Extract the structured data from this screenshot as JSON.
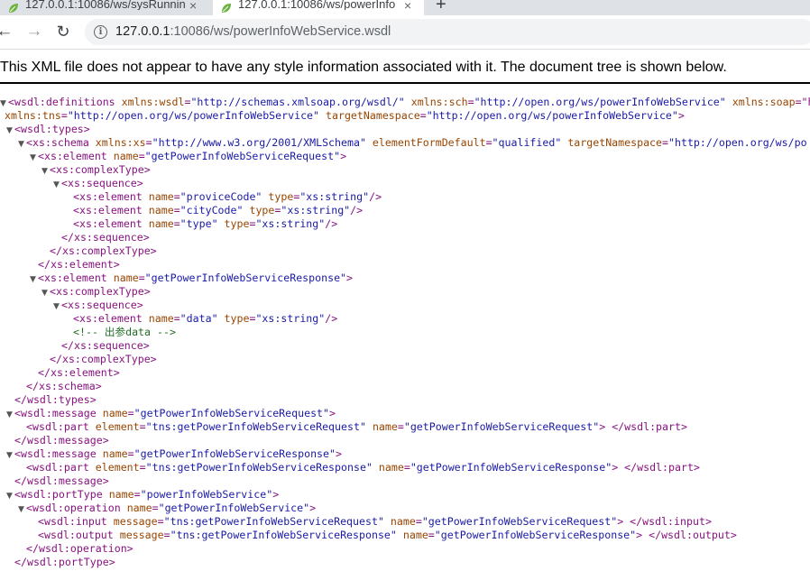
{
  "tabs": [
    {
      "title": "127.0.0.1:10086/ws/sysRunnin",
      "active": false
    },
    {
      "title": "127.0.0.1:10086/ws/powerInfo",
      "active": true
    }
  ],
  "toolbar": {
    "url_host": "127.0.0.1",
    "url_rest": ":10086/ws/powerInfoWebService.wsdl"
  },
  "viewer": {
    "notice": "This XML file does not appear to have any style information associated with it. The document tree is shown below."
  },
  "colors": {
    "tag": "#881280",
    "attr_name": "#994500",
    "attr_value": "#1a1aa6",
    "comment": "#236e25"
  },
  "xml_lines": [
    {
      "indent": 0,
      "toggle": true,
      "parts": [
        [
          "tag",
          "<wsdl:definitions "
        ],
        [
          "an",
          "xmlns:wsdl"
        ],
        [
          "tag",
          "="
        ],
        [
          "av",
          "\"http://schemas.xmlsoap.org/wsdl/\""
        ],
        [
          "tag",
          " "
        ],
        [
          "an",
          "xmlns:sch"
        ],
        [
          "tag",
          "="
        ],
        [
          "av",
          "\"http://open.org/ws/powerInfoWebService\""
        ],
        [
          "tag",
          " "
        ],
        [
          "an",
          "xmlns:soap"
        ],
        [
          "tag",
          "=\"h"
        ]
      ]
    },
    {
      "indent": 0,
      "toggle": false,
      "parts": [
        [
          "an",
          "xmlns:tns"
        ],
        [
          "tag",
          "="
        ],
        [
          "av",
          "\"http://open.org/ws/powerInfoWebService\""
        ],
        [
          "tag",
          " "
        ],
        [
          "an",
          "targetNamespace"
        ],
        [
          "tag",
          "="
        ],
        [
          "av",
          "\"http://open.org/ws/powerInfoWebService\""
        ],
        [
          "tag",
          ">"
        ]
      ]
    },
    {
      "indent": 1,
      "toggle": true,
      "parts": [
        [
          "tag",
          "<wsdl:types>"
        ]
      ]
    },
    {
      "indent": 2,
      "toggle": true,
      "parts": [
        [
          "tag",
          "<xs:schema "
        ],
        [
          "an",
          "xmlns:xs"
        ],
        [
          "tag",
          "="
        ],
        [
          "av",
          "\"http://www.w3.org/2001/XMLSchema\""
        ],
        [
          "tag",
          " "
        ],
        [
          "an",
          "elementFormDefault"
        ],
        [
          "tag",
          "="
        ],
        [
          "av",
          "\"qualified\""
        ],
        [
          "tag",
          " "
        ],
        [
          "an",
          "targetNamespace"
        ],
        [
          "tag",
          "="
        ],
        [
          "av",
          "\"http://open.org/ws/po"
        ]
      ]
    },
    {
      "indent": 3,
      "toggle": true,
      "parts": [
        [
          "tag",
          "<xs:element "
        ],
        [
          "an",
          "name"
        ],
        [
          "tag",
          "="
        ],
        [
          "av",
          "\"getPowerInfoWebServiceRequest\""
        ],
        [
          "tag",
          ">"
        ]
      ]
    },
    {
      "indent": 4,
      "toggle": true,
      "parts": [
        [
          "tag",
          "<xs:complexType>"
        ]
      ]
    },
    {
      "indent": 5,
      "toggle": true,
      "parts": [
        [
          "tag",
          "<xs:sequence>"
        ]
      ]
    },
    {
      "indent": 6,
      "toggle": false,
      "parts": [
        [
          "tag",
          "<xs:element "
        ],
        [
          "an",
          "name"
        ],
        [
          "tag",
          "="
        ],
        [
          "av",
          "\"proviceCode\""
        ],
        [
          "tag",
          " "
        ],
        [
          "an",
          "type"
        ],
        [
          "tag",
          "="
        ],
        [
          "av",
          "\"xs:string\""
        ],
        [
          "tag",
          "/>"
        ]
      ]
    },
    {
      "indent": 6,
      "toggle": false,
      "parts": [
        [
          "tag",
          "<xs:element "
        ],
        [
          "an",
          "name"
        ],
        [
          "tag",
          "="
        ],
        [
          "av",
          "\"cityCode\""
        ],
        [
          "tag",
          " "
        ],
        [
          "an",
          "type"
        ],
        [
          "tag",
          "="
        ],
        [
          "av",
          "\"xs:string\""
        ],
        [
          "tag",
          "/>"
        ]
      ]
    },
    {
      "indent": 6,
      "toggle": false,
      "parts": [
        [
          "tag",
          "<xs:element "
        ],
        [
          "an",
          "name"
        ],
        [
          "tag",
          "="
        ],
        [
          "av",
          "\"type\""
        ],
        [
          "tag",
          " "
        ],
        [
          "an",
          "type"
        ],
        [
          "tag",
          "="
        ],
        [
          "av",
          "\"xs:string\""
        ],
        [
          "tag",
          "/>"
        ]
      ]
    },
    {
      "indent": 5,
      "toggle": false,
      "parts": [
        [
          "tag",
          "</xs:sequence>"
        ]
      ]
    },
    {
      "indent": 4,
      "toggle": false,
      "parts": [
        [
          "tag",
          "</xs:complexType>"
        ]
      ]
    },
    {
      "indent": 3,
      "toggle": false,
      "parts": [
        [
          "tag",
          "</xs:element>"
        ]
      ]
    },
    {
      "indent": 3,
      "toggle": true,
      "parts": [
        [
          "tag",
          "<xs:element "
        ],
        [
          "an",
          "name"
        ],
        [
          "tag",
          "="
        ],
        [
          "av",
          "\"getPowerInfoWebServiceResponse\""
        ],
        [
          "tag",
          ">"
        ]
      ]
    },
    {
      "indent": 4,
      "toggle": true,
      "parts": [
        [
          "tag",
          "<xs:complexType>"
        ]
      ]
    },
    {
      "indent": 5,
      "toggle": true,
      "parts": [
        [
          "tag",
          "<xs:sequence>"
        ]
      ]
    },
    {
      "indent": 6,
      "toggle": false,
      "parts": [
        [
          "tag",
          "<xs:element "
        ],
        [
          "an",
          "name"
        ],
        [
          "tag",
          "="
        ],
        [
          "av",
          "\"data\""
        ],
        [
          "tag",
          " "
        ],
        [
          "an",
          "type"
        ],
        [
          "tag",
          "="
        ],
        [
          "av",
          "\"xs:string\""
        ],
        [
          "tag",
          "/>"
        ]
      ]
    },
    {
      "indent": 6,
      "toggle": false,
      "parts": [
        [
          "cm",
          "<!-- 出参data -->"
        ]
      ]
    },
    {
      "indent": 5,
      "toggle": false,
      "parts": [
        [
          "tag",
          "</xs:sequence>"
        ]
      ]
    },
    {
      "indent": 4,
      "toggle": false,
      "parts": [
        [
          "tag",
          "</xs:complexType>"
        ]
      ]
    },
    {
      "indent": 3,
      "toggle": false,
      "parts": [
        [
          "tag",
          "</xs:element>"
        ]
      ]
    },
    {
      "indent": 2,
      "toggle": false,
      "parts": [
        [
          "tag",
          "</xs:schema>"
        ]
      ]
    },
    {
      "indent": 1,
      "toggle": false,
      "parts": [
        [
          "tag",
          "</wsdl:types>"
        ]
      ]
    },
    {
      "indent": 1,
      "toggle": true,
      "parts": [
        [
          "tag",
          "<wsdl:message "
        ],
        [
          "an",
          "name"
        ],
        [
          "tag",
          "="
        ],
        [
          "av",
          "\"getPowerInfoWebServiceRequest\""
        ],
        [
          "tag",
          ">"
        ]
      ]
    },
    {
      "indent": 2,
      "toggle": false,
      "parts": [
        [
          "tag",
          "<wsdl:part "
        ],
        [
          "an",
          "element"
        ],
        [
          "tag",
          "="
        ],
        [
          "av",
          "\"tns:getPowerInfoWebServiceRequest\""
        ],
        [
          "tag",
          " "
        ],
        [
          "an",
          "name"
        ],
        [
          "tag",
          "="
        ],
        [
          "av",
          "\"getPowerInfoWebServiceRequest\""
        ],
        [
          "tag",
          "> </wsdl:part>"
        ]
      ]
    },
    {
      "indent": 1,
      "toggle": false,
      "parts": [
        [
          "tag",
          "</wsdl:message>"
        ]
      ]
    },
    {
      "indent": 1,
      "toggle": true,
      "parts": [
        [
          "tag",
          "<wsdl:message "
        ],
        [
          "an",
          "name"
        ],
        [
          "tag",
          "="
        ],
        [
          "av",
          "\"getPowerInfoWebServiceResponse\""
        ],
        [
          "tag",
          ">"
        ]
      ]
    },
    {
      "indent": 2,
      "toggle": false,
      "parts": [
        [
          "tag",
          "<wsdl:part "
        ],
        [
          "an",
          "element"
        ],
        [
          "tag",
          "="
        ],
        [
          "av",
          "\"tns:getPowerInfoWebServiceResponse\""
        ],
        [
          "tag",
          " "
        ],
        [
          "an",
          "name"
        ],
        [
          "tag",
          "="
        ],
        [
          "av",
          "\"getPowerInfoWebServiceResponse\""
        ],
        [
          "tag",
          "> </wsdl:part>"
        ]
      ]
    },
    {
      "indent": 1,
      "toggle": false,
      "parts": [
        [
          "tag",
          "</wsdl:message>"
        ]
      ]
    },
    {
      "indent": 1,
      "toggle": true,
      "parts": [
        [
          "tag",
          "<wsdl:portType "
        ],
        [
          "an",
          "name"
        ],
        [
          "tag",
          "="
        ],
        [
          "av",
          "\"powerInfoWebService\""
        ],
        [
          "tag",
          ">"
        ]
      ]
    },
    {
      "indent": 2,
      "toggle": true,
      "parts": [
        [
          "tag",
          "<wsdl:operation "
        ],
        [
          "an",
          "name"
        ],
        [
          "tag",
          "="
        ],
        [
          "av",
          "\"getPowerInfoWebService\""
        ],
        [
          "tag",
          ">"
        ]
      ]
    },
    {
      "indent": 3,
      "toggle": false,
      "parts": [
        [
          "tag",
          "<wsdl:input "
        ],
        [
          "an",
          "message"
        ],
        [
          "tag",
          "="
        ],
        [
          "av",
          "\"tns:getPowerInfoWebServiceRequest\""
        ],
        [
          "tag",
          " "
        ],
        [
          "an",
          "name"
        ],
        [
          "tag",
          "="
        ],
        [
          "av",
          "\"getPowerInfoWebServiceRequest\""
        ],
        [
          "tag",
          "> </wsdl:input>"
        ]
      ]
    },
    {
      "indent": 3,
      "toggle": false,
      "parts": [
        [
          "tag",
          "<wsdl:output "
        ],
        [
          "an",
          "message"
        ],
        [
          "tag",
          "="
        ],
        [
          "av",
          "\"tns:getPowerInfoWebServiceResponse\""
        ],
        [
          "tag",
          " "
        ],
        [
          "an",
          "name"
        ],
        [
          "tag",
          "="
        ],
        [
          "av",
          "\"getPowerInfoWebServiceResponse\""
        ],
        [
          "tag",
          "> </wsdl:output>"
        ]
      ]
    },
    {
      "indent": 2,
      "toggle": false,
      "parts": [
        [
          "tag",
          "</wsdl:operation>"
        ]
      ]
    },
    {
      "indent": 1,
      "toggle": false,
      "parts": [
        [
          "tag",
          "</wsdl:portType>"
        ]
      ]
    }
  ]
}
